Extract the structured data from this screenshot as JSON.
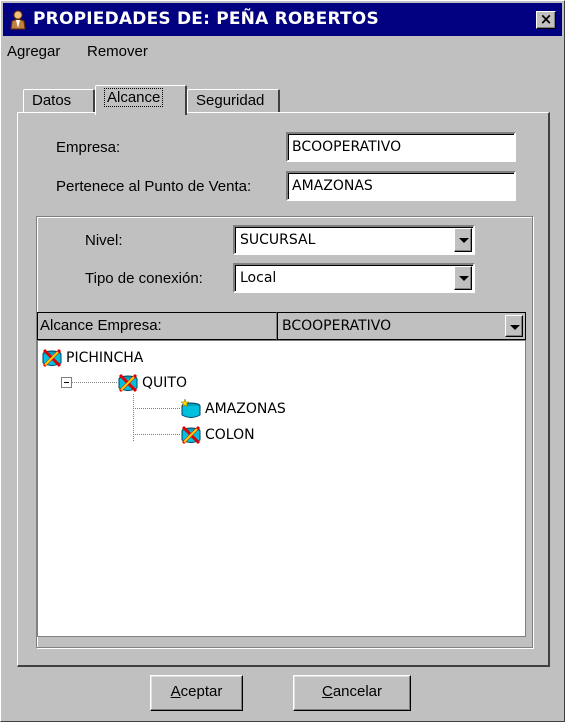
{
  "window": {
    "title": "PROPIEDADES DE: PEÑA ROBERTOS",
    "close_label": "×"
  },
  "menu": {
    "items": [
      "Agregar",
      "Remover"
    ]
  },
  "tabs": [
    {
      "label": "Datos",
      "active": false
    },
    {
      "label": "Alcance",
      "active": true
    },
    {
      "label": "Seguridad",
      "active": false
    }
  ],
  "form": {
    "empresa_label": "Empresa:",
    "empresa_value": "BCOOPERATIVO",
    "punto_venta_label": "Pertenece al Punto de Venta:",
    "punto_venta_value": "AMAZONAS",
    "nivel_label": "Nivel:",
    "nivel_value": "SUCURSAL",
    "conexion_label": "Tipo de conexión:",
    "conexion_value": "Local",
    "alcance_label": "Alcance Empresa:",
    "alcance_value": "BCOOPERATIVO"
  },
  "tree": {
    "nodes": [
      {
        "label": "PICHINCHA",
        "icon": "database-locked-icon"
      },
      {
        "label": "QUITO",
        "icon": "database-locked-icon"
      },
      {
        "label": "AMAZONAS",
        "icon": "database-selected-icon"
      },
      {
        "label": "COLON",
        "icon": "database-locked-icon"
      }
    ]
  },
  "buttons": {
    "accept_first": "A",
    "accept_rest": "ceptar",
    "cancel_first": "C",
    "cancel_rest": "ancelar"
  },
  "colors": {
    "titlebar": "#000080",
    "face": "#c0c0c0",
    "field": "#ffffff"
  }
}
